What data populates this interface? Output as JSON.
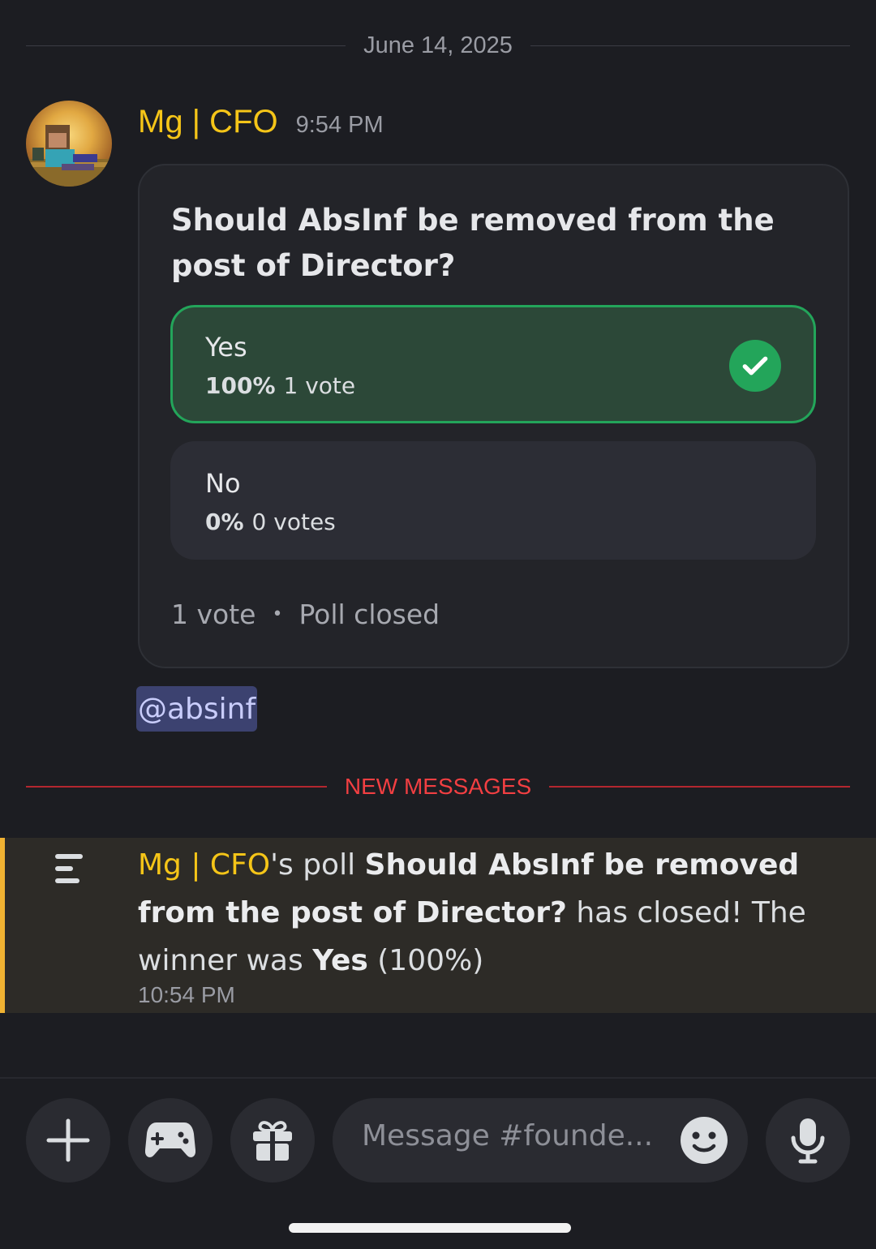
{
  "date_divider": "June 14, 2025",
  "message": {
    "username": "Mg | CFO",
    "timestamp": "9:54 PM",
    "mention": "@absinf"
  },
  "poll": {
    "question": "Should AbsInf be removed from the post of Director?",
    "options": [
      {
        "label": "Yes",
        "percent": "100%",
        "votes": "1 vote",
        "winner": true
      },
      {
        "label": "No",
        "percent": "0%",
        "votes": "0 votes",
        "winner": false
      }
    ],
    "footer_votes": "1 vote",
    "footer_dot": "•",
    "footer_status": "Poll closed"
  },
  "new_messages_label": "NEW MESSAGES",
  "system_message": {
    "username": "Mg | CFO",
    "possessive": "'s poll ",
    "question": "Should AbsInf be removed from the post of Director?",
    "middle": " has closed! The winner was ",
    "winner": "Yes",
    "result": " (100%)",
    "timestamp": "10:54 PM"
  },
  "composer": {
    "placeholder": "Message #founde...",
    "buttons": [
      "plus-icon",
      "gamepad-icon",
      "gift-icon",
      "emoji-icon",
      "microphone-icon"
    ]
  },
  "colors": {
    "username": "#f5c518",
    "winner_border": "#23a55a",
    "new_messages": "#f23f42",
    "system_accent": "#f0b232"
  }
}
